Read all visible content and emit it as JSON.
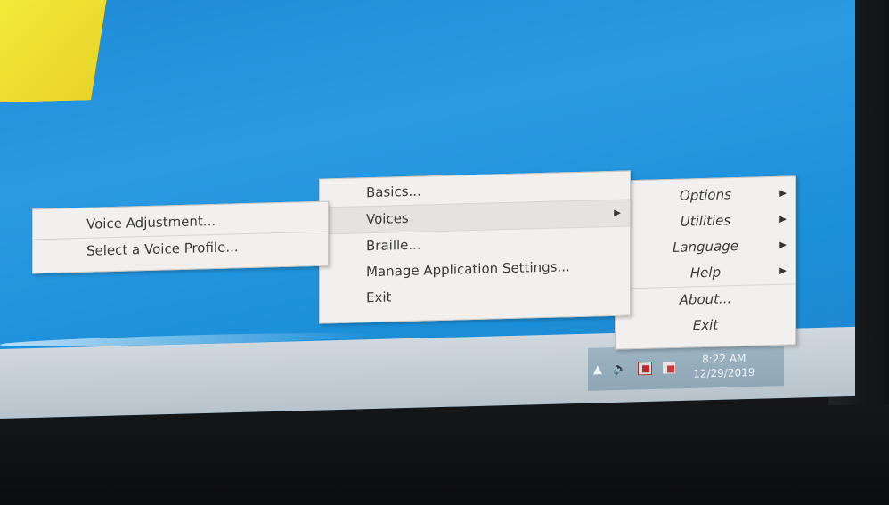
{
  "main_menu": {
    "items": [
      {
        "label": "Options",
        "submenu": true
      },
      {
        "label": "Utilities",
        "submenu": true
      },
      {
        "label": "Language",
        "submenu": true
      },
      {
        "label": "Help",
        "submenu": true
      },
      {
        "label": "About...",
        "submenu": false
      },
      {
        "label": "Exit",
        "submenu": false
      }
    ]
  },
  "options_menu": {
    "items": [
      {
        "label": "Basics...",
        "submenu": false
      },
      {
        "label": "Voices",
        "submenu": true
      },
      {
        "label": "Braille...",
        "submenu": false
      },
      {
        "label": "Manage Application Settings...",
        "submenu": false
      },
      {
        "label": "Exit",
        "submenu": false
      }
    ]
  },
  "voices_menu": {
    "items": [
      {
        "label": "Voice Adjustment..."
      },
      {
        "label": "Select a Voice Profile..."
      }
    ]
  },
  "taskbar": {
    "show_hidden_icon": "up-arrow-icon",
    "volume_icon": "speaker-icon",
    "time": "8:22 AM",
    "date": "12/29/2019"
  },
  "colors": {
    "desktop": "#1f8ad6",
    "menu_bg": "#f1f0ee",
    "taskbar": "#c4ced5"
  }
}
